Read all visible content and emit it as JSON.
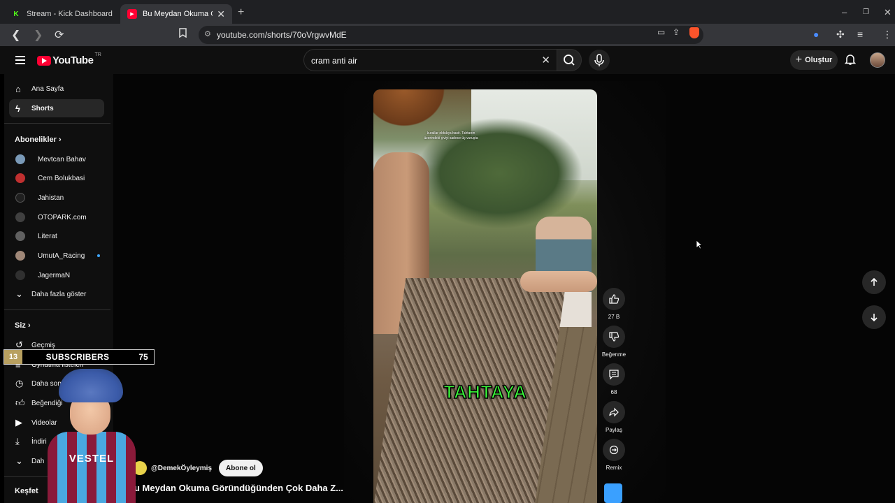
{
  "browser": {
    "tabs": [
      {
        "label": "Stream - Kick Dashboard",
        "favicon": "K"
      },
      {
        "label": "Bu Meydan Okuma Göründ",
        "favicon": "yt"
      }
    ],
    "url": "youtube.com/shorts/70oVrgwvMdE"
  },
  "youtube": {
    "logo_text": "YouTube",
    "country": "TR",
    "search_query": "cram anti air",
    "create_label": "Oluştur"
  },
  "sidebar": {
    "main": [
      {
        "label": "Ana Sayfa",
        "icon": "home-icon"
      },
      {
        "label": "Shorts",
        "icon": "shorts-icon"
      }
    ],
    "subs_header": "Abonelikler",
    "subscriptions": [
      {
        "label": "Mevtcan Bahav",
        "color": "#7a9ab8"
      },
      {
        "label": "Cem Bolukbasi",
        "color": "#c03030"
      },
      {
        "label": "Jahistan",
        "color": "#202020"
      },
      {
        "label": "OTOPARK.com",
        "color": "#404040"
      },
      {
        "label": "Literat",
        "color": "#606060"
      },
      {
        "label": "UmutA_Racing",
        "color": "#a08878"
      },
      {
        "label": "JagermaN",
        "color": "#303030"
      }
    ],
    "show_more": "Daha fazla göster",
    "you_header": "Siz",
    "you_items": [
      {
        "label": "Geçmiş",
        "icon": "history-icon"
      },
      {
        "label": "Oynatma listeleri",
        "icon": "playlist-icon"
      },
      {
        "label": "Daha sonra iz",
        "icon": "clock-icon"
      },
      {
        "label": "Beğendiği",
        "icon": "like-icon"
      },
      {
        "label": "Videolar",
        "icon": "video-icon"
      },
      {
        "label": "İndiri",
        "icon": "download-icon"
      },
      {
        "label": "Dah",
        "icon": "chevron-down-icon"
      }
    ],
    "explore_header": "Keşfet"
  },
  "short": {
    "overlay_text": "kurallar oldukça basit. Tahtanın üzerindeki çiviyi sadece üç vuruşta",
    "caption": "TAHTAYA",
    "channel": "@DemekÖyleymiş",
    "subscribe_label": "Abone ol",
    "title": "u Meydan Okuma Göründüğünden Çok Daha Z..."
  },
  "actions": {
    "likes": "27 B",
    "dislike": "Beğenme",
    "comments": "68",
    "share": "Paylaş",
    "remix": "Remix"
  },
  "overlay": {
    "rank": "13",
    "label": "SUBSCRIBERS",
    "count": "75",
    "kid_shirt": "VESTEL"
  }
}
